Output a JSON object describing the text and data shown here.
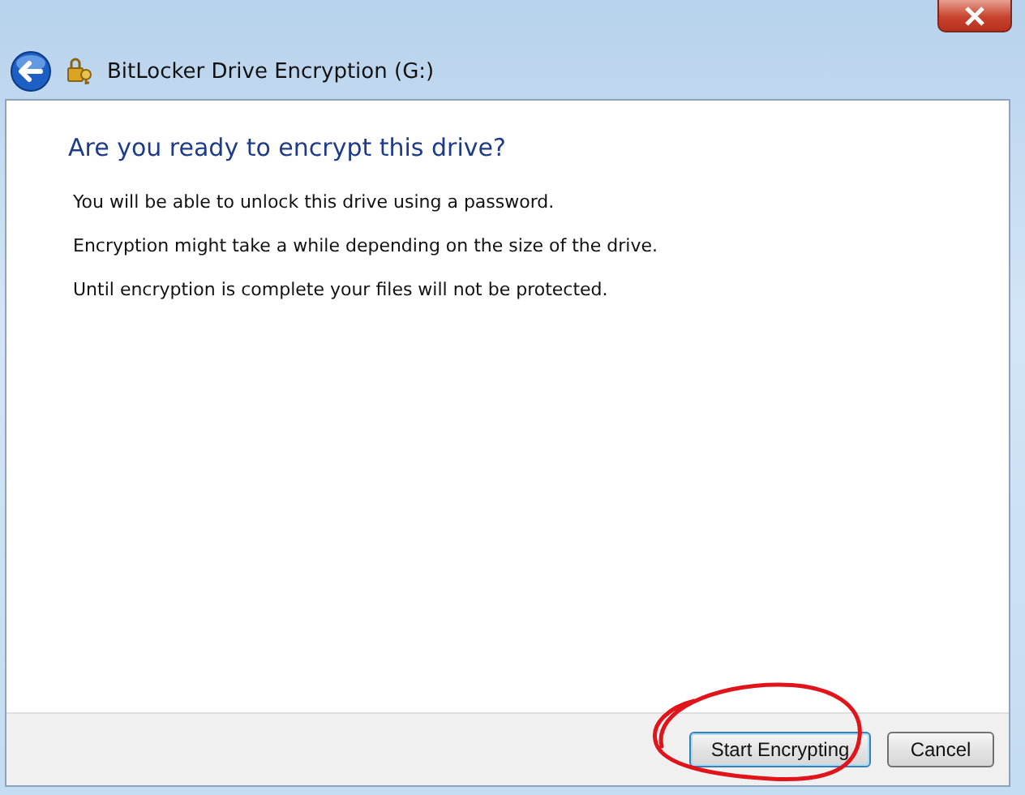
{
  "window": {
    "title": "BitLocker Drive Encryption (G:)"
  },
  "heading": "Are you ready to encrypt this drive?",
  "paragraphs": [
    "You will be able to unlock this drive using a password.",
    "Encryption might take a while depending on the size of the drive.",
    "Until encryption is complete your files will not be protected."
  ],
  "buttons": [
    {
      "label": "Start Encrypting",
      "kind": "default"
    },
    {
      "label": "Cancel",
      "kind": "normal"
    }
  ]
}
